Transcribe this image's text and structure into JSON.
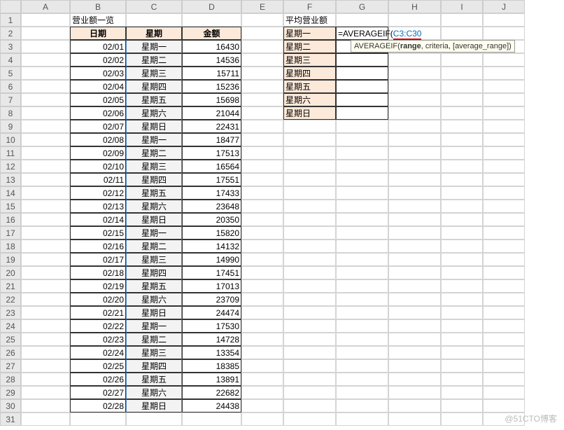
{
  "columns": [
    "A",
    "B",
    "C",
    "D",
    "E",
    "F",
    "G",
    "H",
    "I",
    "J"
  ],
  "rows": [
    "1",
    "2",
    "3",
    "4",
    "5",
    "6",
    "7",
    "8",
    "9",
    "10",
    "11",
    "12",
    "13",
    "14",
    "15",
    "16",
    "17",
    "18",
    "19",
    "20",
    "21",
    "22",
    "23",
    "24",
    "25",
    "26",
    "27",
    "28",
    "29",
    "30",
    "31"
  ],
  "titles": {
    "list_title": "营业额一览",
    "avg_title": "平均营业额",
    "date": "日期",
    "weekday": "星期",
    "amount": "金额"
  },
  "data": [
    {
      "date": "02/01",
      "weekday": "星期一",
      "amount": "16430"
    },
    {
      "date": "02/02",
      "weekday": "星期二",
      "amount": "14536"
    },
    {
      "date": "02/03",
      "weekday": "星期三",
      "amount": "15711"
    },
    {
      "date": "02/04",
      "weekday": "星期四",
      "amount": "15236"
    },
    {
      "date": "02/05",
      "weekday": "星期五",
      "amount": "15698"
    },
    {
      "date": "02/06",
      "weekday": "星期六",
      "amount": "21044"
    },
    {
      "date": "02/07",
      "weekday": "星期日",
      "amount": "22431"
    },
    {
      "date": "02/08",
      "weekday": "星期一",
      "amount": "18477"
    },
    {
      "date": "02/09",
      "weekday": "星期二",
      "amount": "17513"
    },
    {
      "date": "02/10",
      "weekday": "星期三",
      "amount": "16564"
    },
    {
      "date": "02/11",
      "weekday": "星期四",
      "amount": "17551"
    },
    {
      "date": "02/12",
      "weekday": "星期五",
      "amount": "17433"
    },
    {
      "date": "02/13",
      "weekday": "星期六",
      "amount": "23648"
    },
    {
      "date": "02/14",
      "weekday": "星期日",
      "amount": "20350"
    },
    {
      "date": "02/15",
      "weekday": "星期一",
      "amount": "15820"
    },
    {
      "date": "02/16",
      "weekday": "星期二",
      "amount": "14132"
    },
    {
      "date": "02/17",
      "weekday": "星期三",
      "amount": "14990"
    },
    {
      "date": "02/18",
      "weekday": "星期四",
      "amount": "17451"
    },
    {
      "date": "02/19",
      "weekday": "星期五",
      "amount": "17013"
    },
    {
      "date": "02/20",
      "weekday": "星期六",
      "amount": "23709"
    },
    {
      "date": "02/21",
      "weekday": "星期日",
      "amount": "24474"
    },
    {
      "date": "02/22",
      "weekday": "星期一",
      "amount": "17530"
    },
    {
      "date": "02/23",
      "weekday": "星期二",
      "amount": "14728"
    },
    {
      "date": "02/24",
      "weekday": "星期三",
      "amount": "13354"
    },
    {
      "date": "02/25",
      "weekday": "星期四",
      "amount": "18385"
    },
    {
      "date": "02/26",
      "weekday": "星期五",
      "amount": "13891"
    },
    {
      "date": "02/27",
      "weekday": "星期六",
      "amount": "22682"
    },
    {
      "date": "02/28",
      "weekday": "星期日",
      "amount": "24438"
    }
  ],
  "weekdays": [
    "星期一",
    "星期二",
    "星期三",
    "星期四",
    "星期五",
    "星期六",
    "星期日"
  ],
  "formula": {
    "prefix": "=AVERAGEIF(",
    "ref": "C3:C30",
    "tooltip_fn": "AVERAGEIF(",
    "tooltip_range": "range",
    "tooltip_rest": ", criteria, [average_range])"
  },
  "watermark": "@51CTO博客"
}
